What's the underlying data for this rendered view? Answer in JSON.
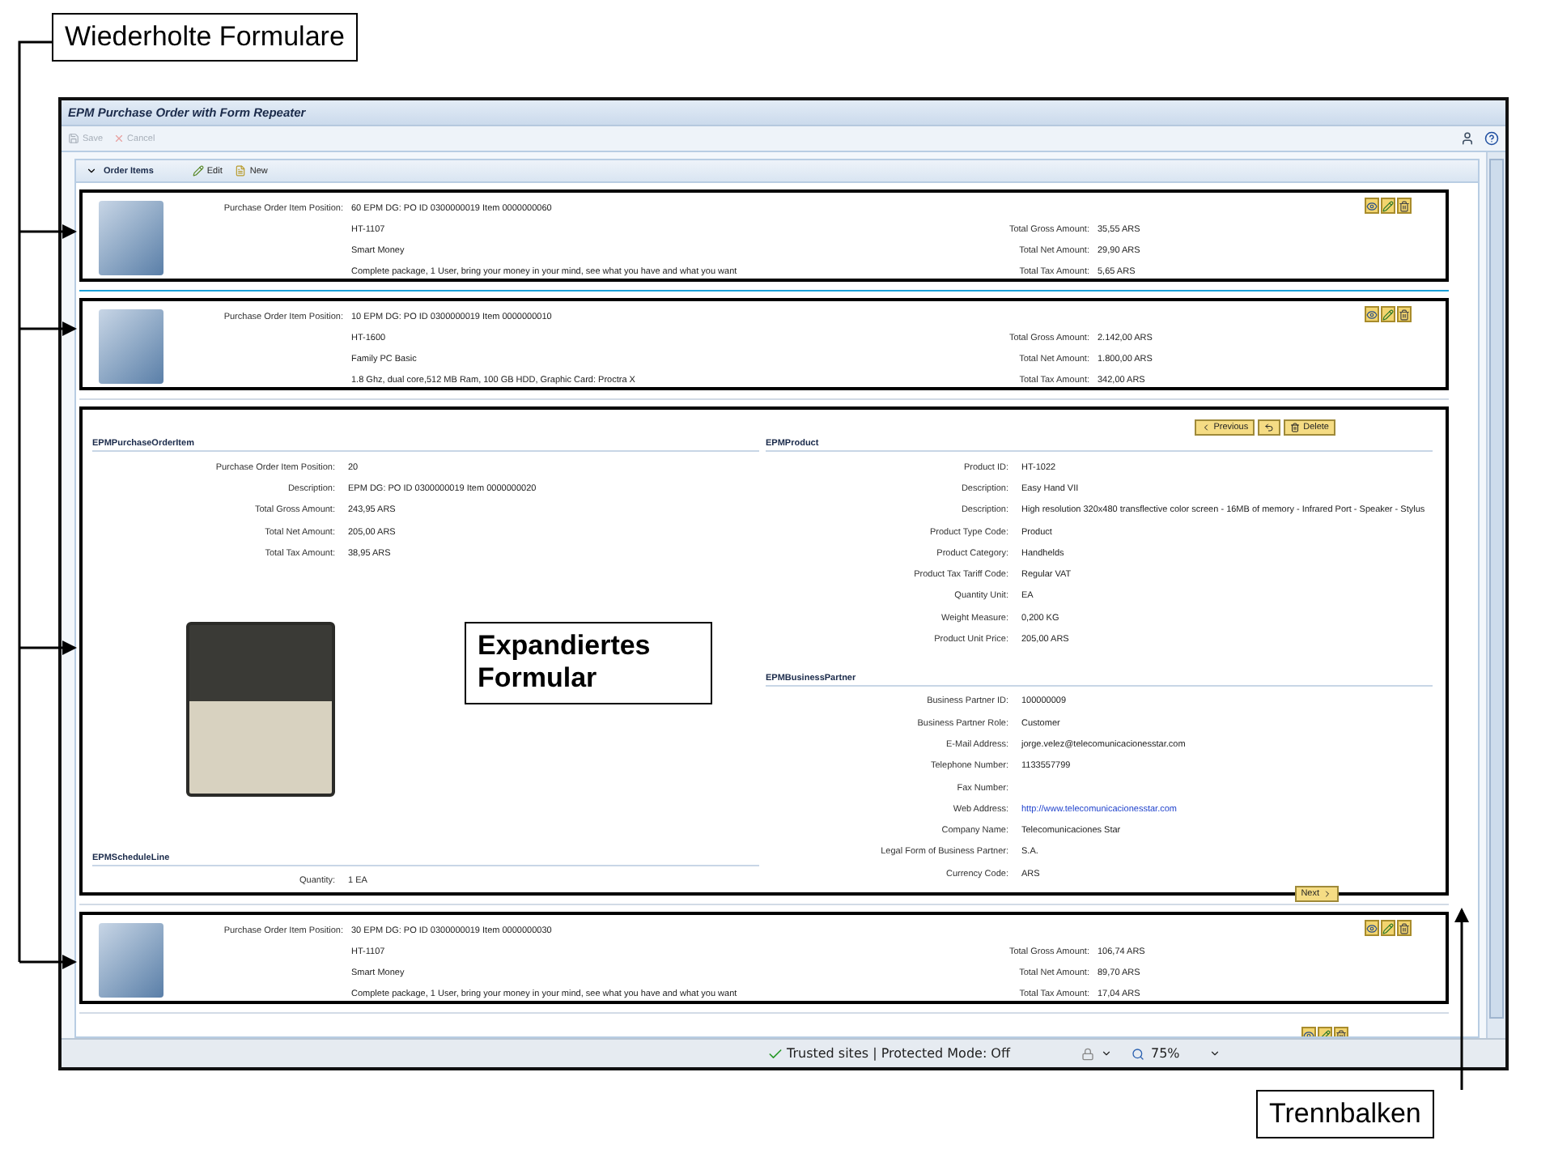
{
  "callouts": {
    "repeated_forms": "Wiederholte Formulare",
    "expanded_form": "Expandiertes Formular",
    "separator": "Trennbalken"
  },
  "window": {
    "title": "EPM Purchase Order with Form Repeater",
    "toolbar": [
      {
        "label": "Save",
        "disabled": true
      },
      {
        "label": "Cancel",
        "disabled": true
      }
    ]
  },
  "panel": {
    "title": "Order Items",
    "actions": [
      "Edit",
      "New"
    ]
  },
  "rows": [
    {
      "kind": "collapsed",
      "position_label": "Purchase Order Item Position:",
      "lines": [
        "60 EPM DG: PO ID 0300000019 Item 0000000060",
        "HT-1107",
        "Smart Money",
        "Complete package, 1 User, bring your money in your mind, see what you have and what you want"
      ],
      "amounts": [
        {
          "label": "Total Gross Amount:",
          "value": "35,55 ARS"
        },
        {
          "label": "Total Net Amount:",
          "value": "29,90 ARS"
        },
        {
          "label": "Total Tax Amount:",
          "value": "5,65 ARS"
        }
      ]
    },
    {
      "kind": "collapsed",
      "position_label": "Purchase Order Item Position:",
      "lines": [
        "10 EPM DG: PO ID 0300000019 Item 0000000010",
        "HT-1600",
        "Family PC Basic",
        "1.8 Ghz, dual core,512 MB Ram, 100 GB HDD, Graphic Card: Proctra X"
      ],
      "amounts": [
        {
          "label": "Total Gross Amount:",
          "value": "2.142,00 ARS"
        },
        {
          "label": "Total Net Amount:",
          "value": "1.800,00 ARS"
        },
        {
          "label": "Total Tax Amount:",
          "value": "342,00 ARS"
        }
      ]
    },
    {
      "kind": "expanded",
      "buttons": [
        "Previous",
        "Delete"
      ],
      "next": "Next",
      "left": [
        {
          "title": "EPMPurchaseOrderItem",
          "fields": [
            {
              "label": "Purchase Order Item Position:",
              "value": "20"
            },
            {
              "label": "Description:",
              "value": "EPM DG: PO ID 0300000019 Item 0000000020"
            },
            {
              "label": "Total Gross Amount:",
              "value": "243,95 ARS"
            },
            {
              "label": "Total Net Amount:",
              "value": "205,00 ARS"
            },
            {
              "label": "Total Tax Amount:",
              "value": "38,95 ARS"
            }
          ]
        },
        {
          "title": "EPMScheduleLine",
          "fields": [
            {
              "label": "Quantity:",
              "value": "1 EA"
            }
          ]
        }
      ],
      "right": [
        {
          "title": "EPMProduct",
          "fields": [
            {
              "label": "Product ID:",
              "value": "HT-1022"
            },
            {
              "label": "Description:",
              "value": "Easy Hand VII"
            },
            {
              "label": "Description:",
              "value": "High resolution 320x480 transflective color screen - 16MB of memory - Infrared Port - Speaker - Stylus"
            },
            {
              "label": "Product Type Code:",
              "value": "Product"
            },
            {
              "label": "Product Category:",
              "value": "Handhelds"
            },
            {
              "label": "Product Tax Tariff Code:",
              "value": "Regular VAT"
            },
            {
              "label": "Quantity Unit:",
              "value": "EA"
            },
            {
              "label": "Weight Measure:",
              "value": "0,200 KG"
            },
            {
              "label": "Product Unit Price:",
              "value": "205,00 ARS"
            }
          ]
        },
        {
          "title": "EPMBusinessPartner",
          "fields": [
            {
              "label": "Business Partner ID:",
              "value": "100000009"
            },
            {
              "label": "Business Partner Role:",
              "value": "Customer"
            },
            {
              "label": "E-Mail Address:",
              "value": "jorge.velez@telecomunicacionesstar.com"
            },
            {
              "label": "Telephone Number:",
              "value": "1133557799"
            },
            {
              "label": "Fax Number:"
            },
            {
              "label": "Web Address:",
              "value": "http://www.telecomunicacionesstar.com",
              "kind": "link"
            },
            {
              "label": "Company Name:",
              "value": "Telecomunicaciones Star"
            },
            {
              "label": "Legal Form of Business Partner:",
              "value": "S.A."
            },
            {
              "label": "Currency Code:",
              "value": "ARS"
            }
          ]
        }
      ]
    },
    {
      "kind": "collapsed",
      "position_label": "Purchase Order Item Position:",
      "lines": [
        "30 EPM DG: PO ID 0300000019 Item 0000000030",
        "HT-1107",
        "Smart Money",
        "Complete package, 1 User, bring your money in your mind, see what you have and what you want"
      ],
      "amounts": [
        {
          "label": "Total Gross Amount:",
          "value": "106,74 ARS"
        },
        {
          "label": "Total Net Amount:",
          "value": "89,70 ARS"
        },
        {
          "label": "Total Tax Amount:",
          "value": "17,04 ARS"
        }
      ]
    },
    {
      "kind": "partial"
    }
  ],
  "status_bar": {
    "zone": "Trusted sites | Protected Mode: Off",
    "zoom": "75%"
  }
}
